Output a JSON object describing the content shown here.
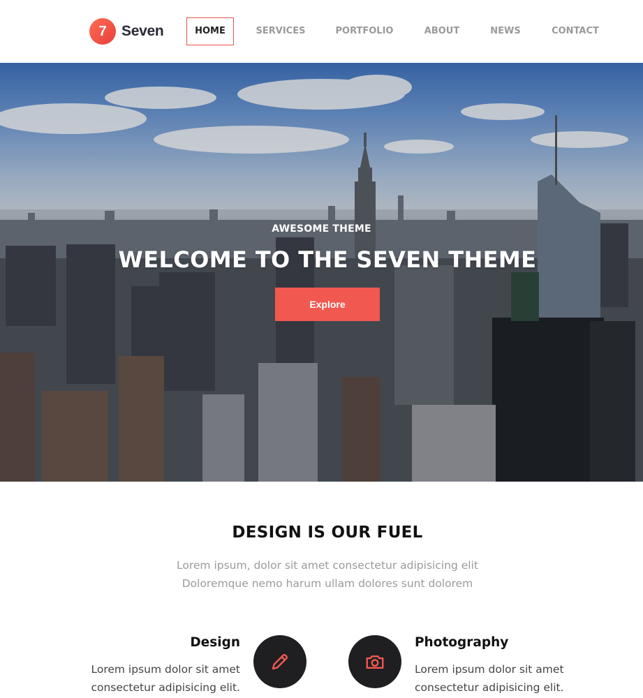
{
  "brand": {
    "badge": "7",
    "name": "Seven"
  },
  "nav": {
    "items": [
      {
        "label": "HOME",
        "active": true
      },
      {
        "label": "SERVICES",
        "active": false
      },
      {
        "label": "PORTFOLIO",
        "active": false
      },
      {
        "label": "ABOUT",
        "active": false
      },
      {
        "label": "NEWS",
        "active": false
      },
      {
        "label": "CONTACT",
        "active": false
      }
    ]
  },
  "hero": {
    "kicker": "AWESOME THEME",
    "title": "WELCOME TO THE SEVEN THEME",
    "button_label": "Explore"
  },
  "intro": {
    "title": "DESIGN IS OUR FUEL",
    "line1": "Lorem ipsum, dolor sit amet consectetur adipisicing elit",
    "line2": "Doloremque nemo harum ullam dolores sunt dolorem"
  },
  "features": [
    {
      "title": "Design",
      "line1": "Lorem ipsum dolor sit amet",
      "line2": "consectetur adipisicing elit.",
      "icon": "pencil-icon"
    },
    {
      "title": "Photography",
      "line1": "Lorem ipsum dolor sit amet",
      "line2": "consectetur adipisicing elit.",
      "icon": "camera-icon"
    }
  ],
  "colors": {
    "accent": "#f1584f",
    "nav_active_border": "#e8504a",
    "icon_circle": "#1f1f22",
    "muted_text": "#9a9a9a"
  }
}
